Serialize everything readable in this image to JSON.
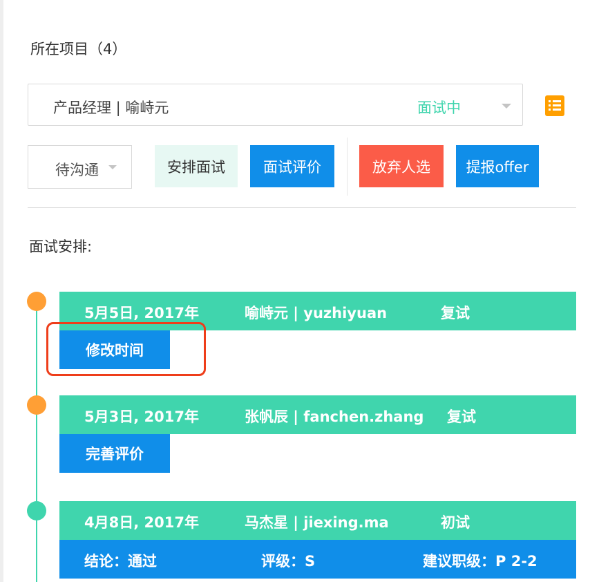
{
  "section": {
    "title": "所在项目（4）"
  },
  "project_select": {
    "name": "产品经理 | 喻峙元",
    "status": "面试中"
  },
  "stage_select": {
    "value": "待沟通"
  },
  "actions": {
    "arrange": "安排面试",
    "evaluate": "面试评价",
    "abandon": "放弃人选",
    "offer": "提报offer"
  },
  "schedule": {
    "title": "面试安排:",
    "interviews": [
      {
        "date": "5月5日, 2017年",
        "interviewer": "喻峙元 | yuzhiyuan",
        "round": "复试",
        "button": "修改时间"
      },
      {
        "date": "5月3日, 2017年",
        "interviewer": "张帆辰 | fanchen.zhang",
        "round": "复试",
        "button": "完善评价"
      },
      {
        "date": "4月8日, 2017年",
        "interviewer": "马杰星 | jiexing.ma",
        "round": "初试",
        "result": {
          "conclusion": "结论：通过",
          "rating": "评级：S",
          "suggested_level": "建议职级：P 2-2"
        }
      }
    ]
  },
  "colors": {
    "accent_green": "#40d5ad",
    "primary_blue": "#108ee9",
    "danger_red": "#fb5c48",
    "dot_orange": "#ff9f35",
    "highlight_red": "#ee3d1a"
  },
  "icons": {
    "list_button": "list-icon",
    "dropdown": "caret-down-icon"
  }
}
